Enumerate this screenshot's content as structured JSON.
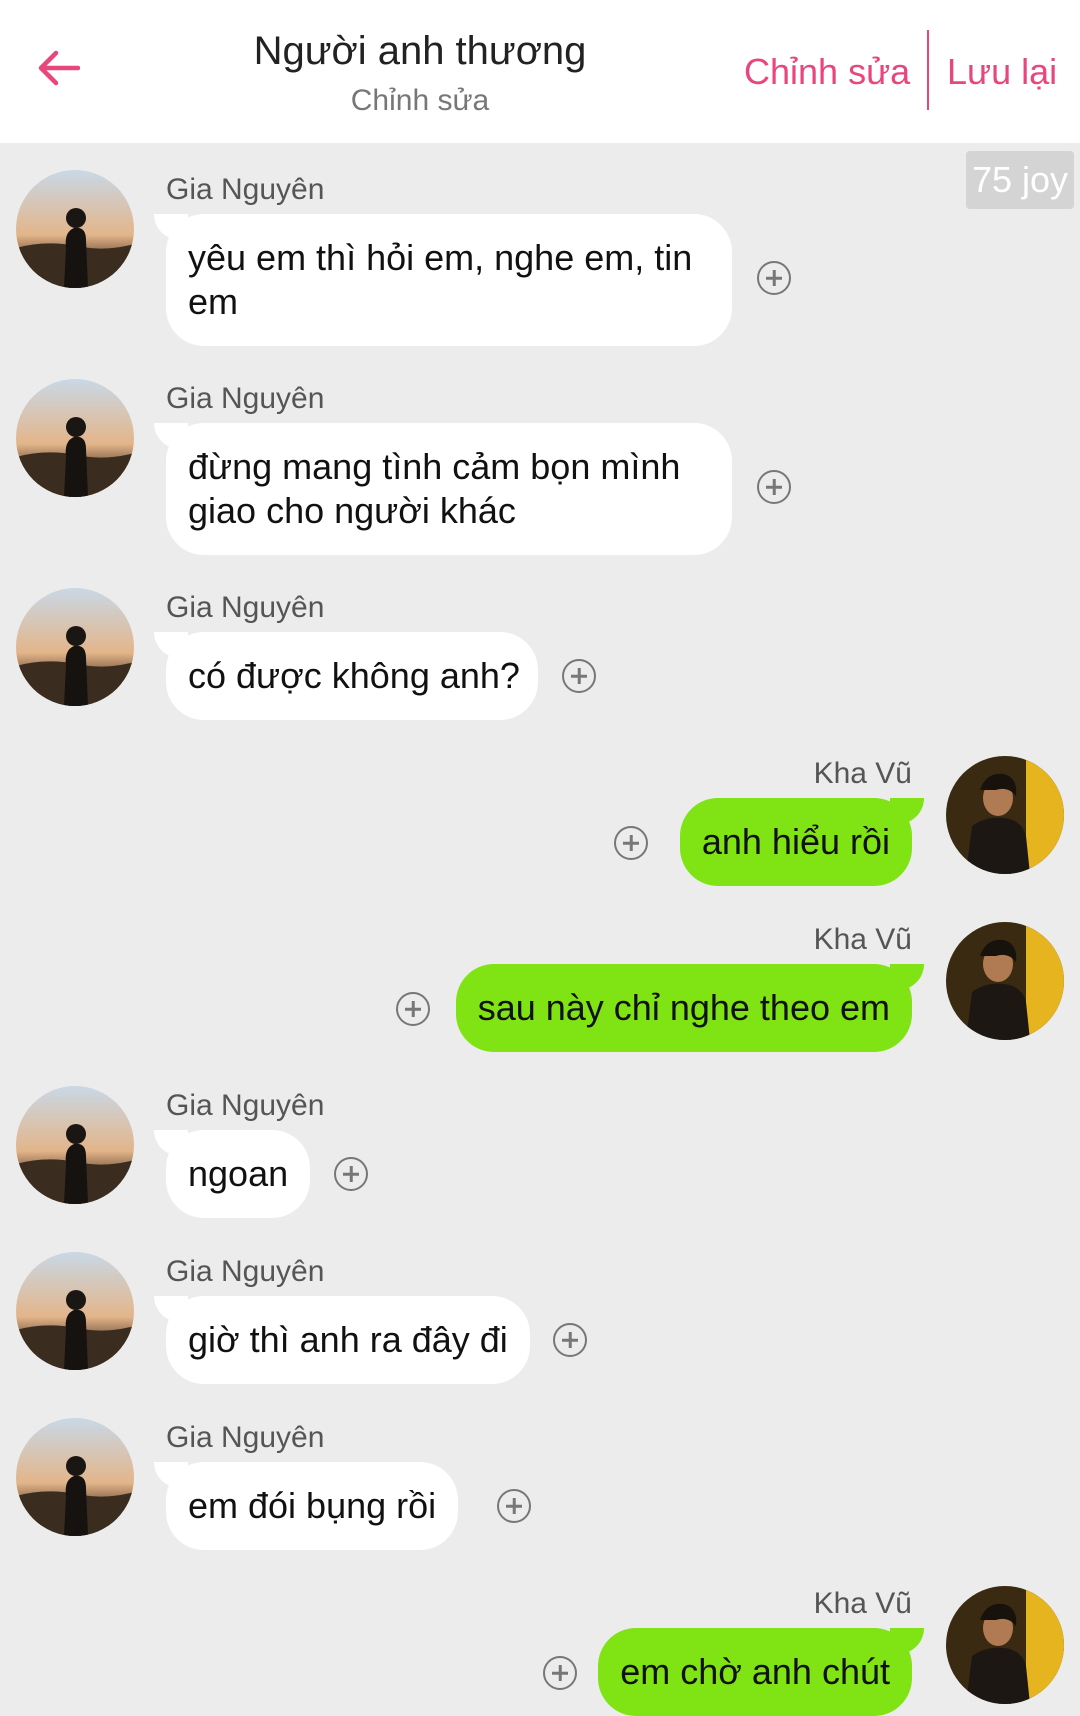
{
  "header": {
    "title": "Người anh thương",
    "subtitle": "Chỉnh sửa",
    "edit_label": "Chỉnh sửa",
    "save_label": "Lưu lại",
    "accent_color": "#e8467c"
  },
  "badge": {
    "text": "75 joy"
  },
  "colors": {
    "incoming_bubble": "#ffffff",
    "outgoing_bubble": "#7fe314",
    "background": "#ececec"
  },
  "messages": [
    {
      "sender": "Gia Nguyên",
      "text": "yêu em thì hỏi em, nghe em, tin em",
      "side": "left"
    },
    {
      "sender": "Gia Nguyên",
      "text": "đừng mang tình cảm bọn mình giao cho người khác",
      "side": "left"
    },
    {
      "sender": "Gia Nguyên",
      "text": "có được không anh?",
      "side": "left"
    },
    {
      "sender": "Kha Vũ",
      "text": "anh hiểu rồi",
      "side": "right"
    },
    {
      "sender": "Kha Vũ",
      "text": "sau này chỉ nghe theo em",
      "side": "right"
    },
    {
      "sender": "Gia Nguyên",
      "text": "ngoan",
      "side": "left"
    },
    {
      "sender": "Gia Nguyên",
      "text": "giờ thì anh ra đây đi",
      "side": "left"
    },
    {
      "sender": "Gia Nguyên",
      "text": "em đói bụng rồi",
      "side": "left"
    },
    {
      "sender": "Kha Vũ",
      "text": "em chờ anh chút",
      "side": "right"
    }
  ]
}
